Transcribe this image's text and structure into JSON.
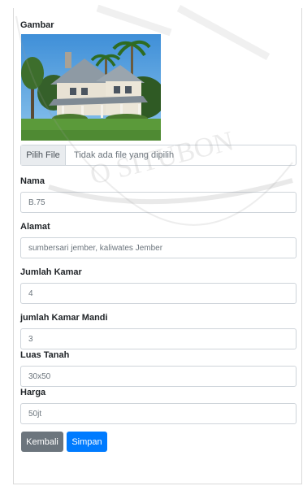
{
  "form": {
    "gambar_label": "Gambar",
    "file_button": "Pilih File",
    "file_status": "Tidak ada file yang dipilih",
    "nama_label": "Nama",
    "nama_value": "B.75",
    "alamat_label": "Alamat",
    "alamat_value": "sumbersari jember, kaliwates Jember",
    "jumlah_kamar_label": "Jumlah Kamar",
    "jumlah_kamar_value": "4",
    "kamar_mandi_label": "jumlah Kamar Mandi",
    "kamar_mandi_value": "3",
    "luas_tanah_label": "Luas Tanah",
    "luas_tanah_value": "30x50",
    "harga_label": "Harga",
    "harga_value": "50jt"
  },
  "buttons": {
    "kembali": "Kembali",
    "simpan": "Simpan"
  },
  "watermark": {
    "text": "O SITUBON"
  },
  "colors": {
    "kembali_bg": "#6c757d",
    "simpan_bg": "#007bff"
  }
}
